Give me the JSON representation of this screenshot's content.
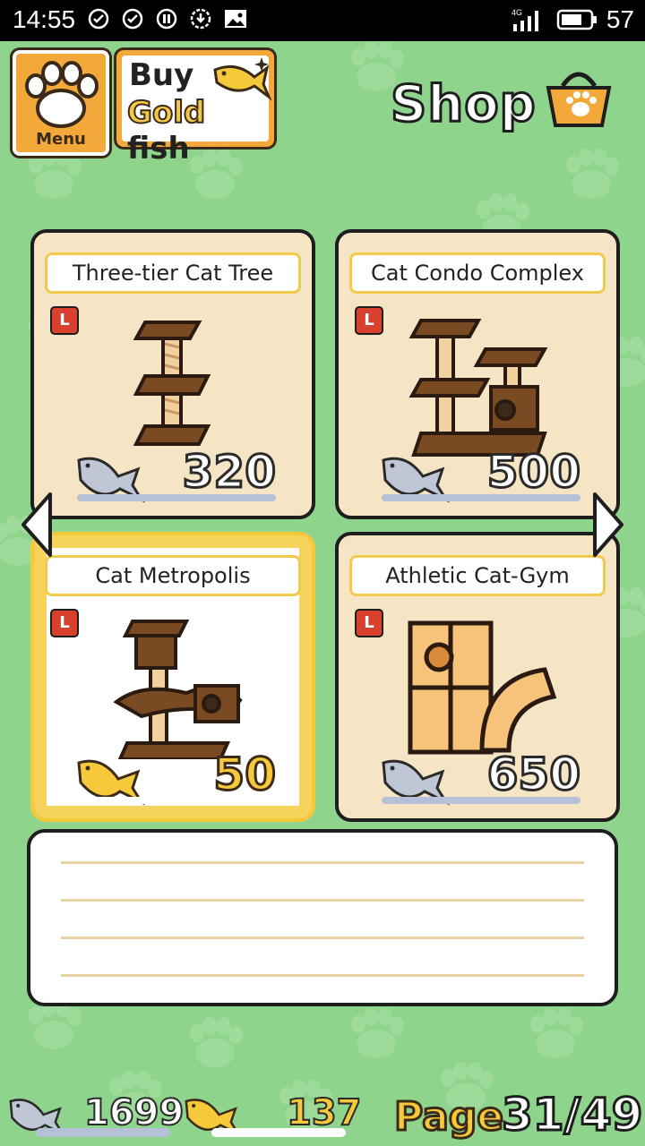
{
  "status_bar": {
    "time": "14:55",
    "network": "4G",
    "battery": "57"
  },
  "header": {
    "menu_label": "Menu",
    "buy_label": "Buy",
    "gold_label": "Gold",
    "fish_label": "fish",
    "title": "Shop"
  },
  "items": [
    {
      "name": "Three-tier Cat Tree",
      "size": "L",
      "price": "320",
      "currency": "silver-fish",
      "selected": false
    },
    {
      "name": "Cat Condo Complex",
      "size": "L",
      "price": "500",
      "currency": "silver-fish",
      "selected": false
    },
    {
      "name": "Cat Metropolis",
      "size": "L",
      "price": "50",
      "currency": "gold-fish",
      "selected": true
    },
    {
      "name": "Athletic Cat-Gym",
      "size": "L",
      "price": "650",
      "currency": "silver-fish",
      "selected": false
    }
  ],
  "description": {
    "lines": 4
  },
  "footer": {
    "silver_fish_count": "1699",
    "gold_fish_count": "137",
    "page_label": "Page",
    "page_current": "31",
    "page_total": "49",
    "page_text": "31/49"
  },
  "colors": {
    "background": "#8fd48c",
    "card": "#f6e5c4",
    "accent_gold": "#f6c93a",
    "size_badge": "#d9412f"
  }
}
